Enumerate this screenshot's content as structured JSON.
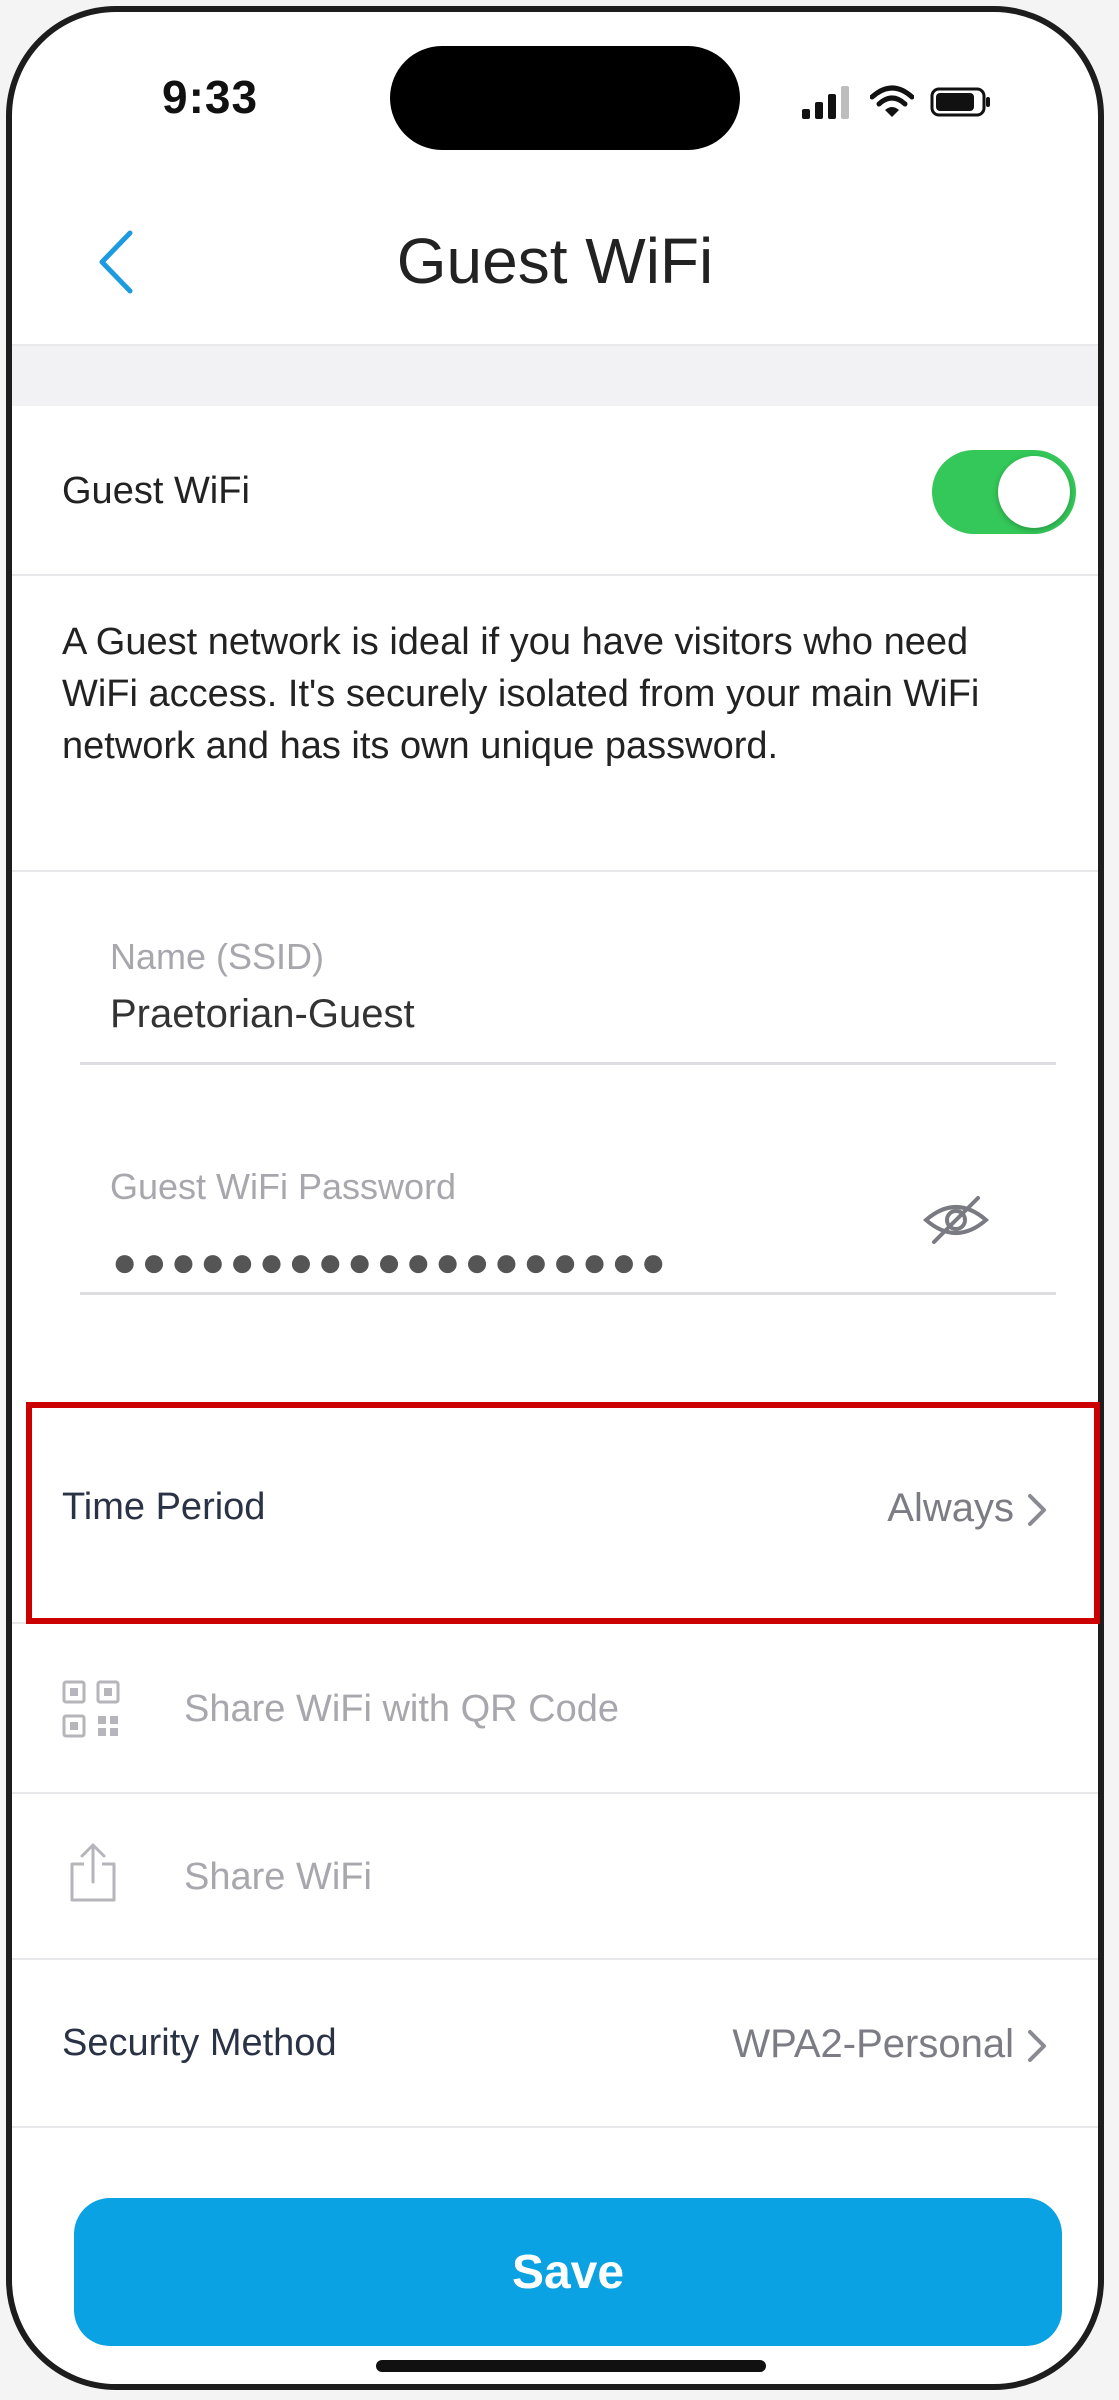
{
  "status_bar": {
    "time": "9:33"
  },
  "header": {
    "title": "Guest WiFi"
  },
  "guest_toggle": {
    "label": "Guest WiFi",
    "enabled": true,
    "on_color": "#34c759"
  },
  "description": "A Guest network is ideal if you have visitors who need WiFi access. It's securely isolated from your main WiFi network and has its own unique password.",
  "ssid": {
    "label": "Name (SSID)",
    "value": "Praetorian-Guest"
  },
  "password": {
    "label": "Guest WiFi Password",
    "masked_value": "●●●●●●●●●●●●●●●●●●●"
  },
  "time_period": {
    "label": "Time Period",
    "value": "Always"
  },
  "share_qr": {
    "label": "Share WiFi with QR Code",
    "icon": "qr-code-icon"
  },
  "share_wifi": {
    "label": "Share WiFi",
    "icon": "share-icon"
  },
  "security": {
    "label": "Security Method",
    "value": "WPA2-Personal"
  },
  "save": {
    "label": "Save",
    "color": "#0aa2e2"
  }
}
